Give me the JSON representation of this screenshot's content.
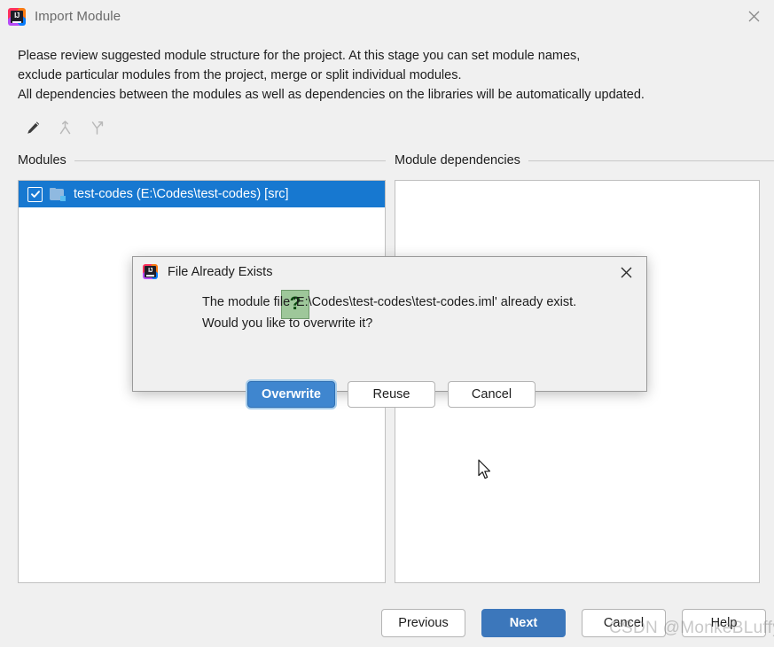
{
  "window": {
    "title": "Import Module",
    "app_icon": "intellij-idea-icon",
    "close_label": "✕",
    "description_lines": [
      "Please review suggested module structure for the project. At this stage you can set module names,",
      "exclude particular modules from the project, merge or split individual modules.",
      "All dependencies between the modules as well as dependencies on the libraries will be automatically updated."
    ]
  },
  "toolbar": {
    "items": [
      {
        "name": "edit-icon",
        "tooltip": "Edit",
        "enabled": true
      },
      {
        "name": "merge-icon",
        "tooltip": "Merge",
        "enabled": false
      },
      {
        "name": "split-icon",
        "tooltip": "Split",
        "enabled": false
      }
    ]
  },
  "panels": {
    "modules": {
      "header": "Modules",
      "rows": [
        {
          "label": "test-codes (E:\\Codes\\test-codes) [src]",
          "checked": true,
          "selected": true,
          "icon": "module-folder-icon"
        }
      ]
    },
    "dependencies": {
      "header": "Module dependencies",
      "rows": []
    }
  },
  "wizard_buttons": [
    {
      "label": "Previous",
      "primary": false
    },
    {
      "label": "Next",
      "primary": true
    },
    {
      "label": "Cancel",
      "primary": false
    },
    {
      "label": "Help",
      "primary": false
    }
  ],
  "dialog": {
    "title": "File Already Exists",
    "app_icon": "intellij-idea-icon",
    "close_label": "✕",
    "icon": "question-mark-icon",
    "message_lines": [
      "The module file 'E:\\Codes\\test-codes\\test-codes.iml' already exist.",
      "Would you like to overwrite it?"
    ],
    "buttons": [
      {
        "label": "Overwrite",
        "primary": true
      },
      {
        "label": "Reuse",
        "primary": false
      },
      {
        "label": "Cancel",
        "primary": false
      }
    ]
  },
  "watermark": {
    "text": "CSDN @MonkeBLuffy"
  },
  "colors": {
    "window_bg": "#f0f0f0",
    "panel_bg": "#ffffff",
    "selection_blue": "#1778d0",
    "primary_button": "#3c77bb",
    "dialog_primary_button": "#3f86cf",
    "question_icon_bg": "#9ec79a",
    "question_icon_fg": "#0b4a10"
  }
}
